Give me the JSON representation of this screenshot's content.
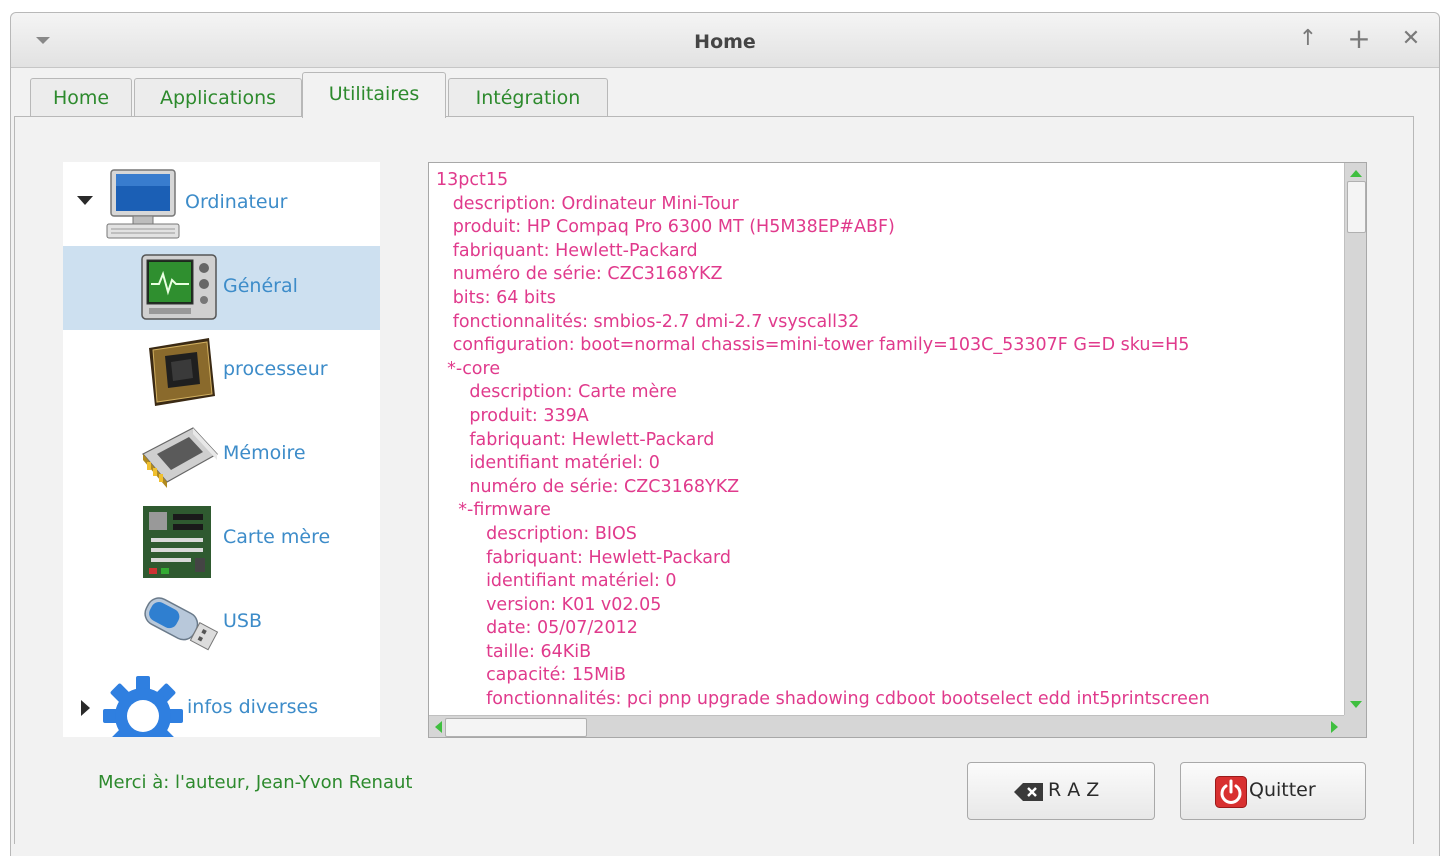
{
  "window": {
    "title": "Home"
  },
  "titlebar_buttons": {
    "minimize": "↑",
    "maximize": "+",
    "close": "✕"
  },
  "tabs": [
    {
      "label": "Home",
      "active": false
    },
    {
      "label": "Applications",
      "active": false
    },
    {
      "label": "Utilitaires",
      "active": true
    },
    {
      "label": "Intégration",
      "active": false
    }
  ],
  "tree": {
    "root": {
      "label": "Ordinateur",
      "icon": "computer-icon",
      "expanded": true
    },
    "children": [
      {
        "label": "Général",
        "icon": "monitor-chart-icon",
        "selected": true
      },
      {
        "label": "processeur",
        "icon": "cpu-chip-icon"
      },
      {
        "label": "Mémoire",
        "icon": "memory-module-icon"
      },
      {
        "label": "Carte mère",
        "icon": "motherboard-icon"
      },
      {
        "label": "USB",
        "icon": "usb-drive-icon"
      }
    ],
    "second_root": {
      "label": "infos diverses",
      "icon": "gear-icon",
      "expanded": false
    }
  },
  "textview": {
    "lines": [
      "13pct15",
      "   description: Ordinateur Mini-Tour",
      "   produit: HP Compaq Pro 6300 MT (H5M38EP#ABF)",
      "   fabriquant: Hewlett-Packard",
      "   numéro de série: CZC3168YKZ",
      "   bits: 64 bits",
      "   fonctionnalités: smbios-2.7 dmi-2.7 vsyscall32",
      "   configuration: boot=normal chassis=mini-tower family=103C_53307F G=D sku=H5",
      "  *-core",
      "      description: Carte mère",
      "      produit: 339A",
      "      fabriquant: Hewlett-Packard",
      "      identifiant matériel: 0",
      "      numéro de série: CZC3168YKZ",
      "    *-firmware",
      "         description: BIOS",
      "         fabriquant: Hewlett-Packard",
      "         identifiant matériel: 0",
      "         version: K01 v02.05",
      "         date: 05/07/2012",
      "         taille: 64KiB",
      "         capacité: 15MiB",
      "         fonctionnalités: pci pnp upgrade shadowing cdboot bootselect edd int5printscreen"
    ]
  },
  "footer": {
    "credits": "Merci à: l'auteur, Jean-Yvon Renaut"
  },
  "buttons": {
    "raz": {
      "label": "R A Z",
      "icon": "backspace-icon"
    },
    "quit": {
      "label": "Quitter",
      "icon": "power-icon"
    }
  },
  "colors": {
    "green_text": "#2d8a2d",
    "tree_text": "#3d8cc9",
    "detail_text": "#e03a8c",
    "selection": "#cde0f0"
  }
}
